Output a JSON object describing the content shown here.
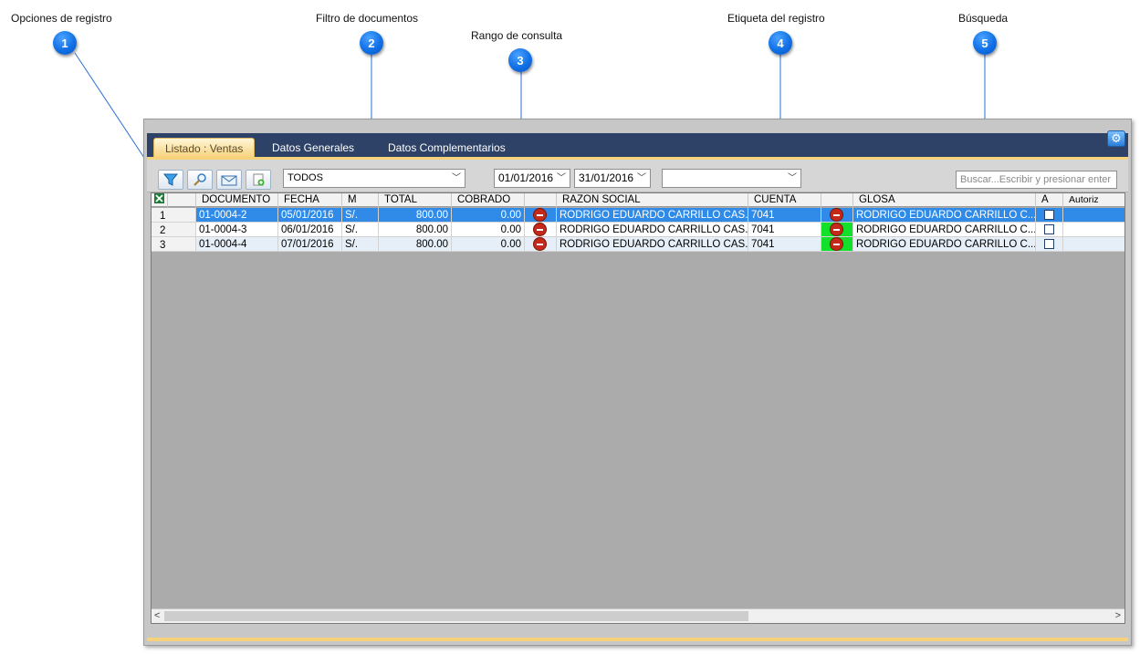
{
  "callouts": [
    {
      "label": "Opciones de registro",
      "number": "1"
    },
    {
      "label": "Filtro de documentos",
      "number": "2"
    },
    {
      "label": "Rango de consulta",
      "number": "3"
    },
    {
      "label": "Etiqueta del registro",
      "number": "4"
    },
    {
      "label": "Búsqueda",
      "number": "5"
    }
  ],
  "tabs": [
    "Listado : Ventas",
    "Datos Generales",
    "Datos Complementarios"
  ],
  "toolbar": {
    "filter_value": "TODOS",
    "date_from": "01/01/2016",
    "date_to": "31/01/2016",
    "tag_value": "",
    "search_placeholder": "Buscar...Escribir y presionar enter"
  },
  "icons": {
    "excel": "excel-icon",
    "settings": "gear-icon",
    "filter": "filter-icon",
    "search": "magnifier-icon",
    "mail": "mail-icon",
    "new_doc": "new-document-icon",
    "status": "stop-icon"
  },
  "colors": {
    "title_bar": "#2d4266",
    "selected_row": "#2f8ae8",
    "active_tab": "#f7d27a",
    "status_red": "#c42a1a",
    "status_green": "#13e02b"
  },
  "grid": {
    "columns": [
      "DOCUMENTO",
      "FECHA",
      "M",
      "TOTAL",
      "COBRADO",
      "",
      "RAZON SOCIAL",
      "CUENTA",
      "",
      "GLOSA",
      "A",
      "Autoriz"
    ],
    "rows": [
      {
        "n": "1",
        "documento": "01-0004-2",
        "fecha": "05/01/2016",
        "m": "S/.",
        "total": "800.00",
        "cobrado": "0.00",
        "razon": "RODRIGO EDUARDO CARRILLO CAS...",
        "cuenta": "7041",
        "glosa": "RODRIGO EDUARDO  CARRILLO C..."
      },
      {
        "n": "2",
        "documento": "01-0004-3",
        "fecha": "06/01/2016",
        "m": "S/.",
        "total": "800.00",
        "cobrado": "0.00",
        "razon": "RODRIGO EDUARDO CARRILLO CAS...",
        "cuenta": "7041",
        "glosa": "RODRIGO EDUARDO  CARRILLO C..."
      },
      {
        "n": "3",
        "documento": "01-0004-4",
        "fecha": "07/01/2016",
        "m": "S/.",
        "total": "800.00",
        "cobrado": "0.00",
        "razon": "RODRIGO EDUARDO CARRILLO CAS...",
        "cuenta": "7041",
        "glosa": "RODRIGO EDUARDO  CARRILLO C..."
      }
    ]
  }
}
